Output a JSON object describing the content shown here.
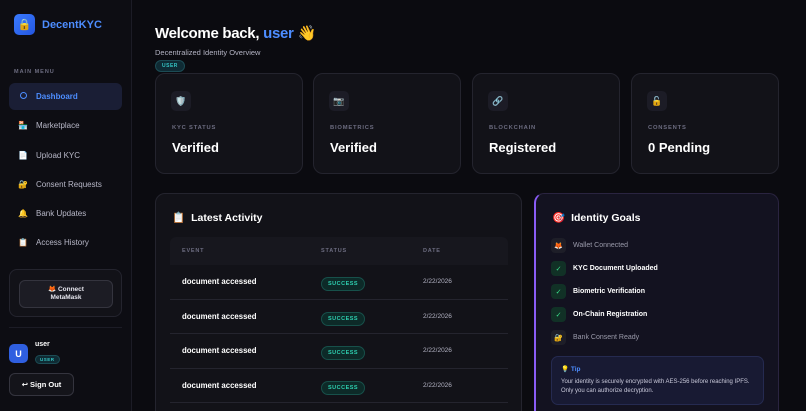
{
  "brand": {
    "name": "DecentKYC",
    "logo_icon": "🔒"
  },
  "sidebar": {
    "menu_label": "MAIN MENU",
    "items": [
      {
        "label": "Dashboard",
        "icon": "ring-icon",
        "active": true
      },
      {
        "label": "Marketplace",
        "icon": "🏪"
      },
      {
        "label": "Upload KYC",
        "icon": "📄"
      },
      {
        "label": "Consent Requests",
        "icon": "🔐"
      },
      {
        "label": "Bank Updates",
        "icon": "🔔"
      },
      {
        "label": "Access History",
        "icon": "📋"
      }
    ],
    "connect_button": {
      "icon": "🦊",
      "line1": "Connect",
      "line2": "MetaMask"
    },
    "user": {
      "initial": "U",
      "name": "user",
      "role": "USER"
    },
    "signout_label": "↩ Sign Out"
  },
  "header": {
    "welcome_prefix": "Welcome back,",
    "username": "user",
    "wave": "👋",
    "subtitle": "Decentralized Identity Overview",
    "badge": "USER"
  },
  "stats": [
    {
      "icon": "🛡️",
      "label": "KYC STATUS",
      "value": "Verified"
    },
    {
      "icon": "📷",
      "label": "BIOMETRICS",
      "value": "Verified"
    },
    {
      "icon": "🔗",
      "label": "BLOCKCHAIN",
      "value": "Registered"
    },
    {
      "icon": "🔓",
      "label": "CONSENTS",
      "value": "0 Pending"
    }
  ],
  "activity": {
    "icon": "📋",
    "title": "Latest Activity",
    "columns": [
      "EVENT",
      "STATUS",
      "DATE"
    ],
    "rows": [
      {
        "event": "document accessed",
        "status": "SUCCESS",
        "date": "2/22/2026"
      },
      {
        "event": "document accessed",
        "status": "SUCCESS",
        "date": "2/22/2026"
      },
      {
        "event": "document accessed",
        "status": "SUCCESS",
        "date": "2/22/2026"
      },
      {
        "event": "document accessed",
        "status": "SUCCESS",
        "date": "2/22/2026"
      }
    ]
  },
  "goals": {
    "icon": "🎯",
    "title": "Identity Goals",
    "items": [
      {
        "label": "Wallet Connected",
        "icon": "🦊",
        "done": false
      },
      {
        "label": "KYC Document Uploaded",
        "icon": "✓",
        "done": true
      },
      {
        "label": "Biometric Verification",
        "icon": "✓",
        "done": true
      },
      {
        "label": "On-Chain Registration",
        "icon": "✓",
        "done": true
      },
      {
        "label": "Bank Consent Ready",
        "icon": "🔐",
        "done": false
      }
    ],
    "tip": {
      "title": "💡 Tip",
      "text": "Your identity is securely encrypted with AES-256 before reaching IPFS. Only you can authorize decryption."
    }
  }
}
